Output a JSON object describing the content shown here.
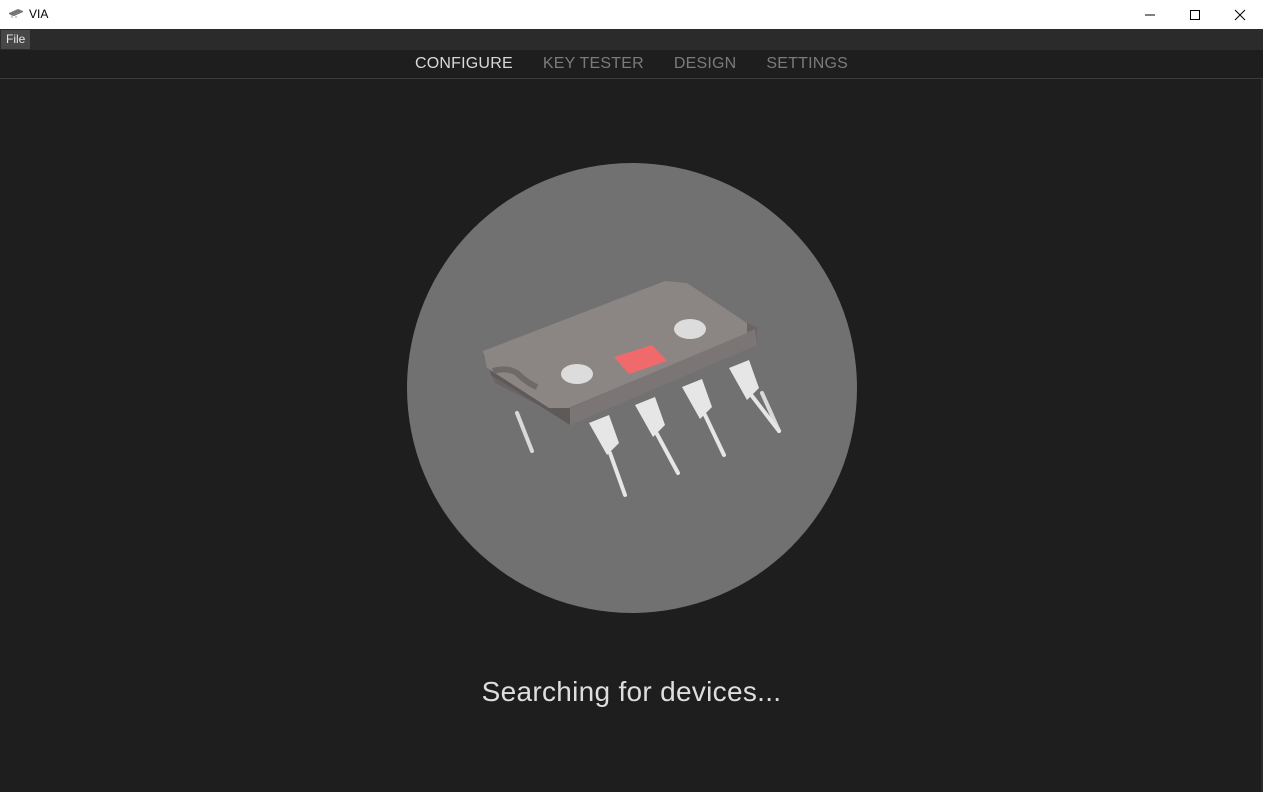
{
  "window": {
    "title": "VIA",
    "controls": {
      "minimize": "minimize",
      "maximize": "maximize",
      "close": "close"
    }
  },
  "menubar": {
    "items": [
      {
        "label": "File"
      }
    ]
  },
  "nav": {
    "tabs": [
      {
        "label": "CONFIGURE",
        "active": true
      },
      {
        "label": "KEY TESTER",
        "active": false
      },
      {
        "label": "DESIGN",
        "active": false
      },
      {
        "label": "SETTINGS",
        "active": false
      }
    ]
  },
  "main": {
    "illustration": "microchip-icon",
    "status_text": "Searching for devices..."
  },
  "colors": {
    "background": "#1f1e1f",
    "circle": "#717171",
    "chip_body": "#8b8584",
    "chip_label": "#f06a6b",
    "tab_active": "#d9d9d9",
    "tab_inactive": "#7b7b7b"
  }
}
